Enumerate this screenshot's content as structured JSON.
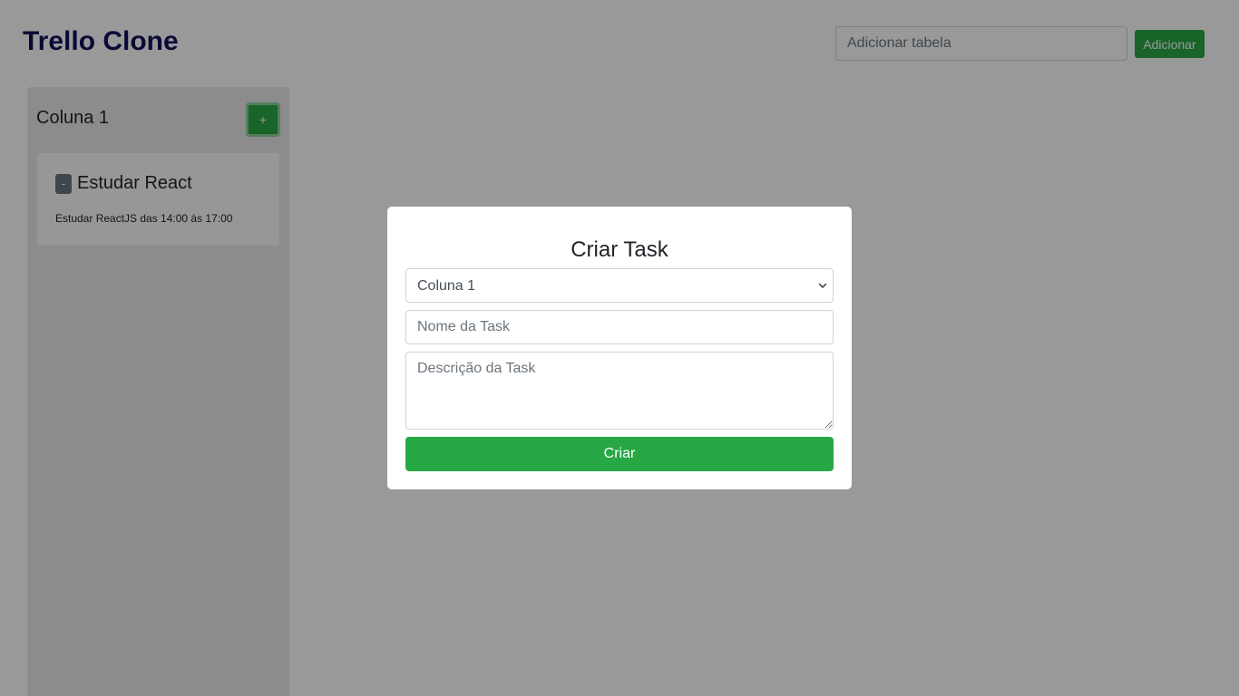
{
  "header": {
    "title": "Trello Clone",
    "add_table_placeholder": "Adicionar tabela",
    "add_table_button": "Adicionar"
  },
  "board": {
    "columns": [
      {
        "title": "Coluna 1",
        "add_button": "+",
        "tasks": [
          {
            "remove_button": "-",
            "title": "Estudar React",
            "description": "Estudar ReactJS das 14:00 às 17:00"
          }
        ]
      }
    ]
  },
  "modal": {
    "title": "Criar Task",
    "column_select": {
      "selected": "Coluna 1",
      "options": [
        "Coluna 1"
      ]
    },
    "task_name_placeholder": "Nome da Task",
    "task_description_placeholder": "Descrição da Task",
    "submit_button": "Criar"
  },
  "colors": {
    "primary_green": "#28a745",
    "title_color": "#12125a",
    "overlay": "rgba(0,0,0,0.4)"
  },
  "icons": {
    "select_indicator": "chevron-down-icon"
  }
}
